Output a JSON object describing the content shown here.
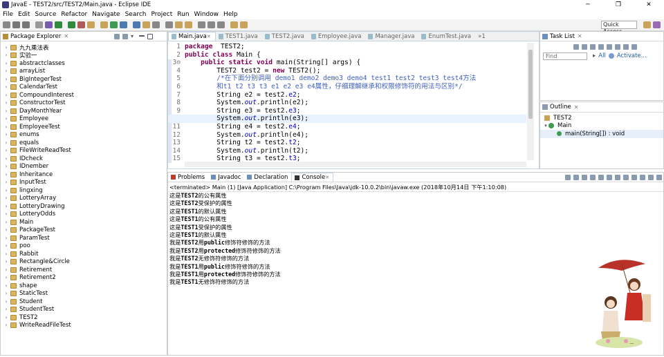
{
  "window": {
    "title": "JavaE - TEST2/src/TEST2/Main.java - Eclipse IDE",
    "min": "─",
    "max": "❐",
    "close": "✕"
  },
  "menu": [
    "File",
    "Edit",
    "Source",
    "Refactor",
    "Navigate",
    "Search",
    "Project",
    "Run",
    "Window",
    "Help"
  ],
  "quick_access": "Quick Access",
  "package_explorer": {
    "title": "Package Explorer",
    "items": [
      "九九乘法表",
      "实验一",
      "abstractclasses",
      "arrayList",
      "BigIntegerTest",
      "CalendarTest",
      "CompoundInterest",
      "ConstructorTest",
      "DayMonthYear",
      "Employee",
      "EmployeeTest",
      "enums",
      "equals",
      "FileWriteReadTest",
      "IDcheck",
      "IDnember",
      "Inheritance",
      "InputTest",
      "lingxing",
      "LotteryArray",
      "LotteryDrawing",
      "LotteryOdds",
      "Main",
      "PackageTest",
      "ParamTest",
      "poo",
      "Rabbit",
      "Rectangle&Circle",
      "Retirement",
      "Retirement2",
      "shape",
      "StaticTest",
      "Student",
      "StudentTest",
      "TEST2",
      "WriteReadFileTest"
    ]
  },
  "editor": {
    "tabs": [
      {
        "label": "Main.java",
        "active": true
      },
      {
        "label": "TEST1.java",
        "active": false
      },
      {
        "label": "TEST2.java",
        "active": false
      },
      {
        "label": "Employee.java",
        "active": false
      },
      {
        "label": "Manager.java",
        "active": false
      },
      {
        "label": "EnumTest.java",
        "active": false
      }
    ],
    "overflow": "»1",
    "line_numbers": [
      "1",
      "2",
      "3⊖",
      "4",
      "5",
      "6",
      "7",
      "8",
      "9",
      "10",
      "11",
      "12",
      "13",
      "14",
      "15"
    ],
    "lines": [
      [
        [
          "kw",
          "package"
        ],
        [
          "",
          "  TEST2;"
        ]
      ],
      [
        [
          "kw",
          "public"
        ],
        [
          "",
          ""
        ],
        [
          "kw",
          " class"
        ],
        [
          "",
          " Main {"
        ]
      ],
      [
        [
          "",
          "    "
        ],
        [
          "kw",
          "public"
        ],
        [
          "kw",
          " static"
        ],
        [
          "kw",
          " void"
        ],
        [
          "",
          " main(String[] args) {"
        ]
      ],
      [
        [
          "",
          "        TEST2 test2 = "
        ],
        [
          "kw",
          "new"
        ],
        [
          "",
          " TEST2();"
        ]
      ],
      [
        [
          "",
          "        "
        ],
        [
          "cm",
          "/*在下面分别调用 demo1 demo2 demo3 demo4 test1 test2 test3 test4方法"
        ]
      ],
      [
        [
          "cm",
          "        和t1 t2 t3 t3 e1 e2 e3 e4属性，仔细理解继承和权限修饰符的用法与区别*/"
        ]
      ],
      [
        [
          "",
          "        String e2 = test2."
        ],
        [
          "fld",
          "e2"
        ],
        [
          "",
          ";"
        ]
      ],
      [
        [
          "",
          "        System."
        ],
        [
          "st",
          "out"
        ],
        [
          "",
          ".println(e2);"
        ]
      ],
      [
        [
          "",
          "        String e3 = test2."
        ],
        [
          "fld",
          "e3"
        ],
        [
          "",
          ";"
        ]
      ],
      [
        [
          "",
          "        System."
        ],
        [
          "st",
          "out"
        ],
        [
          "",
          ".println(e3);"
        ]
      ],
      [
        [
          "",
          "        String e4 = test2."
        ],
        [
          "fld",
          "e4"
        ],
        [
          "",
          ";"
        ]
      ],
      [
        [
          "",
          "        System."
        ],
        [
          "st",
          "out"
        ],
        [
          "",
          ".println(e4);"
        ]
      ],
      [
        [
          "",
          "        String t2 = test2."
        ],
        [
          "fld",
          "t2"
        ],
        [
          "",
          ";"
        ]
      ],
      [
        [
          "",
          "        System."
        ],
        [
          "st",
          "out"
        ],
        [
          "",
          ".println(t2);"
        ]
      ],
      [
        [
          "",
          "        String t3 = test2."
        ],
        [
          "fld",
          "t3"
        ],
        [
          "",
          ";"
        ]
      ]
    ]
  },
  "task_list": {
    "title": "Task List",
    "find_placeholder": "Find",
    "all": "All",
    "activate": "Activate..."
  },
  "outline": {
    "title": "Outline",
    "items": [
      "TEST2",
      "Main",
      "main(String[]) : void"
    ]
  },
  "bottom_tabs": [
    "Problems",
    "Javadoc",
    "Declaration",
    "Console"
  ],
  "console": {
    "status": "<terminated> Main (1) [Java Application] C:\\Program Files\\Java\\jdk-10.0.2\\bin\\javaw.exe (2018年10月14日 下午1:10:08)",
    "lines": [
      [
        [
          "这是",
          ""
        ],
        [
          "TEST2",
          "m"
        ],
        [
          "的公有属性",
          ""
        ]
      ],
      [
        [
          "这是",
          ""
        ],
        [
          "TEST2",
          "m"
        ],
        [
          "受保护的属性",
          ""
        ]
      ],
      [
        [
          "这是",
          ""
        ],
        [
          "TEST1",
          "m"
        ],
        [
          "的默认属性",
          ""
        ]
      ],
      [
        [
          "这是",
          ""
        ],
        [
          "TEST1",
          "m"
        ],
        [
          "的公有属性",
          ""
        ]
      ],
      [
        [
          "这是",
          ""
        ],
        [
          "TEST1",
          "m"
        ],
        [
          "受保护的属性",
          ""
        ]
      ],
      [
        [
          "这是",
          ""
        ],
        [
          "TEST1",
          "m"
        ],
        [
          "的默认属性",
          ""
        ]
      ],
      [
        [
          "我是",
          ""
        ],
        [
          "TEST2",
          "m"
        ],
        [
          "用",
          ""
        ],
        [
          "public",
          "m"
        ],
        [
          "修饰符修饰的方法",
          ""
        ]
      ],
      [
        [
          "我是",
          ""
        ],
        [
          "TEST2",
          "m"
        ],
        [
          "用",
          ""
        ],
        [
          "protected",
          "m"
        ],
        [
          "修饰符修饰的方法",
          ""
        ]
      ],
      [
        [
          "我是",
          ""
        ],
        [
          "TEST2",
          "m"
        ],
        [
          "无修饰符修饰的方法",
          ""
        ]
      ],
      [
        [
          "我是",
          ""
        ],
        [
          "TEST1",
          "m"
        ],
        [
          "用",
          ""
        ],
        [
          "public",
          "m"
        ],
        [
          "修饰符修饰的方法",
          ""
        ]
      ],
      [
        [
          "我是",
          ""
        ],
        [
          "TEST1",
          "m"
        ],
        [
          "用",
          ""
        ],
        [
          "protected",
          "m"
        ],
        [
          "修饰符修饰的方法",
          ""
        ]
      ],
      [
        [
          "我是",
          ""
        ],
        [
          "TEST1",
          "m"
        ],
        [
          "无修饰符修饰的方法",
          ""
        ]
      ]
    ]
  },
  "colors": {
    "keyword": "#7f0055",
    "comment": "#3f5fbf",
    "field": "#0000c0",
    "highlight_line": "#e8f2fe",
    "selected_tab_border": "#c5d3e6"
  }
}
